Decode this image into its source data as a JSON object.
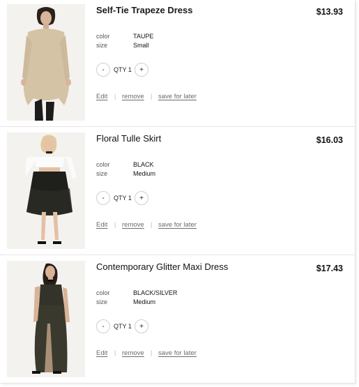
{
  "cart": {
    "items": [
      {
        "name": "Self-Tie Trapeze Dress",
        "price": "$13.93",
        "color_label": "color",
        "color": "TAUPE",
        "size_label": "size",
        "size": "Small",
        "qty_label": "QTY 1",
        "minus": "-",
        "plus": "+",
        "edit": "Edit",
        "remove": "remove",
        "save": "save for later",
        "sep": "|"
      },
      {
        "name": "Floral Tulle Skirt",
        "price": "$16.03",
        "color_label": "color",
        "color": "BLACK",
        "size_label": "size",
        "size": "Medium",
        "qty_label": "QTY 1",
        "minus": "-",
        "plus": "+",
        "edit": "Edit",
        "remove": "remove",
        "save": "save for later",
        "sep": "|"
      },
      {
        "name": "Contemporary Glitter Maxi Dress",
        "price": "$17.43",
        "color_label": "color",
        "color": "BLACK/SILVER",
        "size_label": "size",
        "size": "Medium",
        "qty_label": "QTY 1",
        "minus": "-",
        "plus": "+",
        "edit": "Edit",
        "remove": "remove",
        "save": "save for later",
        "sep": "|"
      }
    ]
  }
}
